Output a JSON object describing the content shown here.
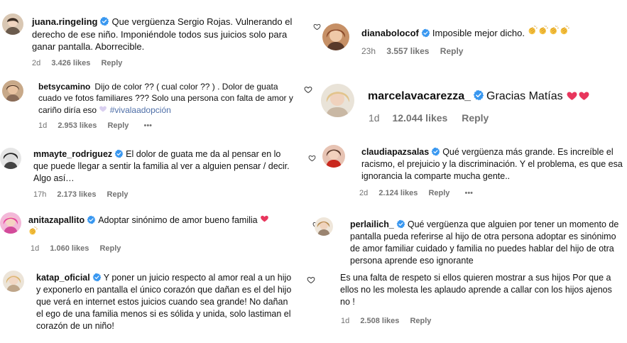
{
  "comments_left": [
    {
      "username": "juana.ringeling",
      "text": "Que vergüenza Sergio Rojas. Vulnerando el derecho de ese niño. Imponiéndole todos sus juicios solo para ganar pantalla. Aborrecible.",
      "time": "2d",
      "likes": "3.426 likes",
      "reply": "Reply"
    },
    {
      "username": "betsycamino",
      "text": "Dijo de color ?? ( cual color ?? ) . Dolor de guata cuado ve fotos familiares ??? Solo una persona con falta de amor y cariño diría eso",
      "emoji": "heart",
      "tag": "#vivalaadopción",
      "time": "1d",
      "likes": "2.953 likes",
      "reply": "Reply",
      "more": "•••"
    },
    {
      "username": "mmayte_rodriguez",
      "text": "El dolor de guata me da al pensar en lo que puede llegar a sentir la familia al ver a alguien pensar / decir. Algo así…",
      "time": "17h",
      "likes": "2.173 likes",
      "reply": "Reply"
    },
    {
      "username": "anitazapallito",
      "text": "Adoptar sinónimo de amor bueno familia",
      "emoji": "heart-clap",
      "time": "1d",
      "likes": "1.060 likes",
      "reply": "Reply"
    },
    {
      "username": "katap_oficial",
      "text": "Y poner un juicio respecto al amor real a un hijo y exponerlo en pantalla el único corazón que dañan es el del hijo que verá en internet estos juicios cuando sea grande! No dañan el ego de una familia menos si es sólida y unida, solo lastiman el corazón de un niño!",
      "time": "",
      "likes": "",
      "reply": ""
    }
  ],
  "comments_right": [
    {
      "username": "dianabolocof",
      "text": "Imposible mejor dicho.",
      "emoji": "four-clap",
      "time": "23h",
      "likes": "3.557 likes",
      "reply": "Reply"
    },
    {
      "username": "marcelavacarezza_",
      "text": "Gracias Matías",
      "emoji": "two-hearts",
      "time": "1d",
      "likes": "12.044 likes",
      "reply": "Reply"
    },
    {
      "username": "claudiapazsalas",
      "text": "Qué vergüenza más grande. Es increíble el racismo, el prejuicio y la discriminación. Y el problema, es que esa ignorancia la comparte mucha gente..",
      "time": "2d",
      "likes": "2.124 likes",
      "reply": "Reply",
      "more": "•••"
    },
    {
      "username": "perlailich_",
      "text": "Qué vergüenza que alguien por tener un momento de pantalla pueda referirse al hijo de otra persona adoptar es sinónimo de amor familiar cuidado y familia no puedes hablar del hijo de otra persona aprende eso ignorante",
      "text2": "Es una falta de respeto si ellos quieren mostrar a sus hijos Por que a ellos no les molesta les aplaudo aprende a callar con los hijos ajenos no !",
      "time": "1d",
      "likes": "2.508 likes",
      "reply": "Reply"
    }
  ],
  "colors": {
    "verified": "#3897f0",
    "meta": "#737373",
    "heart": "#e8365d",
    "hashtag": "#4f6fa8"
  }
}
